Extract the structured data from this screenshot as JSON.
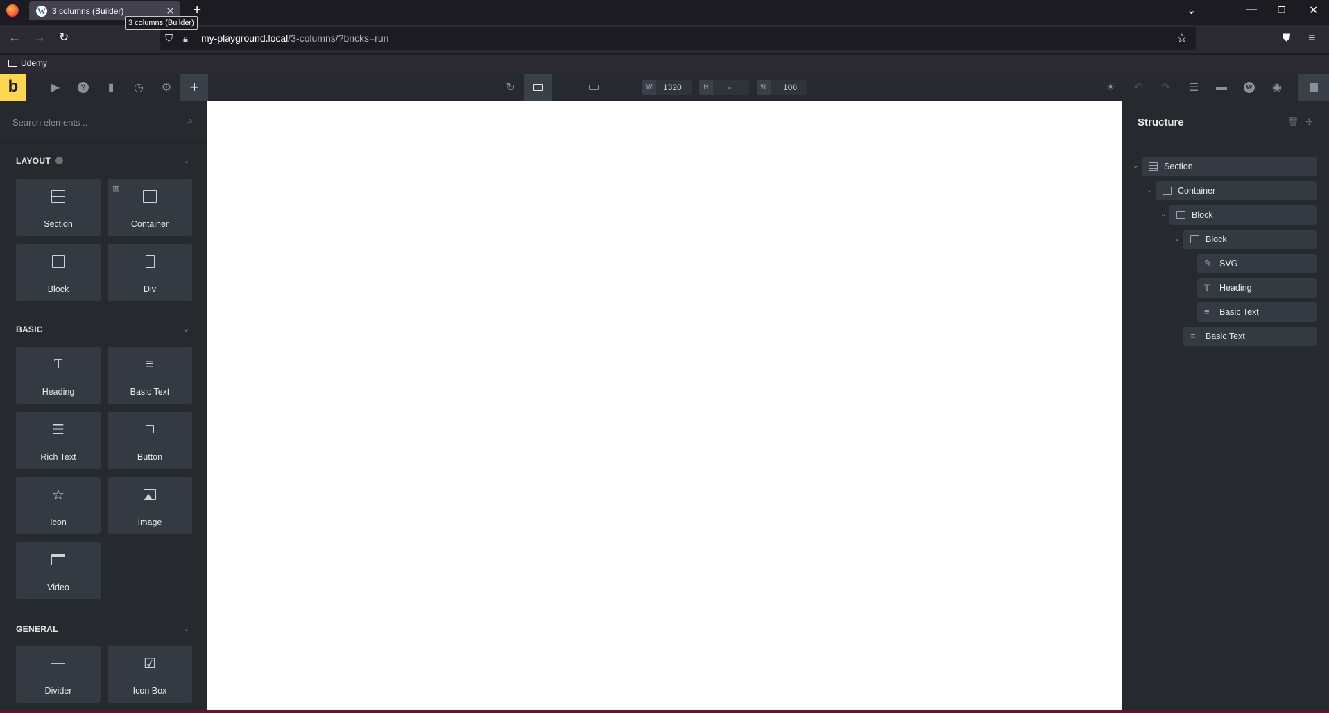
{
  "browser": {
    "tab_title": "3 columns (Builder)",
    "tooltip": "3 columns (Builder)",
    "url_host": "my-playground.local",
    "url_path": "/3-columns/?bricks=run",
    "bookmark": "Udemy"
  },
  "toolbar": {
    "logo": "b",
    "width_label": "W",
    "width_value": "1320",
    "height_label": "H",
    "height_value": "-",
    "zoom_label": "%",
    "zoom_value": "100"
  },
  "elements_panel": {
    "search_placeholder": "Search elements ..",
    "categories": [
      {
        "name": "LAYOUT",
        "items": [
          {
            "label": "Section",
            "icon": "section-icon"
          },
          {
            "label": "Container",
            "icon": "container-icon"
          },
          {
            "label": "Block",
            "icon": "block-icon"
          },
          {
            "label": "Div",
            "icon": "div-icon"
          }
        ]
      },
      {
        "name": "BASIC",
        "items": [
          {
            "label": "Heading",
            "icon": "heading-icon"
          },
          {
            "label": "Basic Text",
            "icon": "basic-text-icon"
          },
          {
            "label": "Rich Text",
            "icon": "rich-text-icon"
          },
          {
            "label": "Button",
            "icon": "button-icon"
          },
          {
            "label": "Icon",
            "icon": "star-icon"
          },
          {
            "label": "Image",
            "icon": "image-icon"
          },
          {
            "label": "Video",
            "icon": "video-icon"
          }
        ]
      },
      {
        "name": "GENERAL",
        "items": [
          {
            "label": "Divider",
            "icon": "divider-icon"
          },
          {
            "label": "Icon Box",
            "icon": "icon-box-icon"
          }
        ]
      }
    ]
  },
  "structure_panel": {
    "title": "Structure",
    "nodes": [
      {
        "label": "Section",
        "icon": "section-icon",
        "depth": 0
      },
      {
        "label": "Container",
        "icon": "container-icon",
        "depth": 1
      },
      {
        "label": "Block",
        "icon": "block-icon",
        "depth": 2
      },
      {
        "label": "Block",
        "icon": "block-icon",
        "depth": 3
      },
      {
        "label": "SVG",
        "icon": "svg-icon",
        "depth": 4
      },
      {
        "label": "Heading",
        "icon": "heading-icon",
        "depth": 4
      },
      {
        "label": "Basic Text",
        "icon": "basic-text-icon",
        "depth": 4
      },
      {
        "label": "Basic Text",
        "icon": "basic-text-icon",
        "depth": 3
      }
    ]
  }
}
